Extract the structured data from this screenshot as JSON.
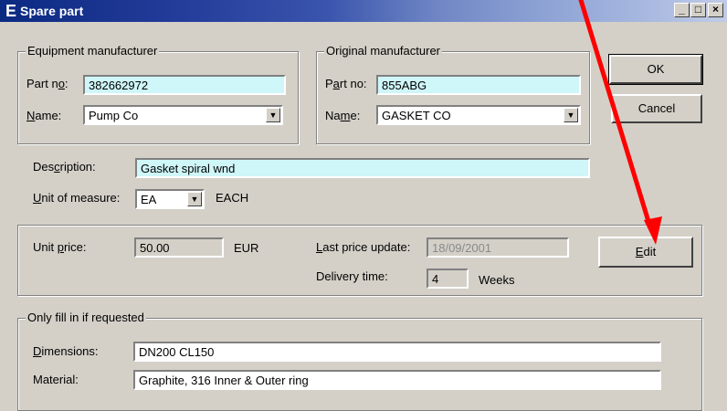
{
  "window": {
    "title": "Spare part",
    "app_icon": "E",
    "min": "_",
    "max": "□",
    "close": "×"
  },
  "equip": {
    "group_label": "Equipment manufacturer",
    "part_label_pre": "Part n",
    "part_label_u": "o",
    "part_label_post": ":",
    "part_value": "382662972",
    "name_label_u": "N",
    "name_label_post": "ame:",
    "name_value": "Pump Co"
  },
  "orig": {
    "group_label": "Original manufacturer",
    "part_label_pre": "P",
    "part_label_u": "a",
    "part_label_post": "rt no:",
    "part_value": "855ABG",
    "name_label_pre": "Na",
    "name_label_u": "m",
    "name_label_post": "e:",
    "name_value": "GASKET CO"
  },
  "buttons": {
    "ok": "OK",
    "cancel": "Cancel",
    "edit_u": "E",
    "edit_post": "dit"
  },
  "description": {
    "label_pre": "Des",
    "label_u": "c",
    "label_post": "ription:",
    "value": "Gasket spiral wnd"
  },
  "uom": {
    "label_u": "U",
    "label_post": "nit of measure:",
    "value": "EA",
    "text": "EACH"
  },
  "price": {
    "label_pre": "Unit ",
    "label_u": "p",
    "label_post": "rice:",
    "value": "50.00",
    "currency": "EUR",
    "last_update_u": "L",
    "last_update_post": "ast price update:",
    "last_update_value": "18/09/2001",
    "delivery_label": "Delivery time:",
    "delivery_value": "4",
    "delivery_unit": "Weeks"
  },
  "optional": {
    "group_label": "Only fill in if requested",
    "dim_u": "D",
    "dim_post": "imensions:",
    "dim_value": "DN200 CL150",
    "material_label": "Material:",
    "material_value": "Graphite, 316 Inner & Outer ring"
  },
  "annotation": {
    "arrow_color": "#ff0000"
  }
}
